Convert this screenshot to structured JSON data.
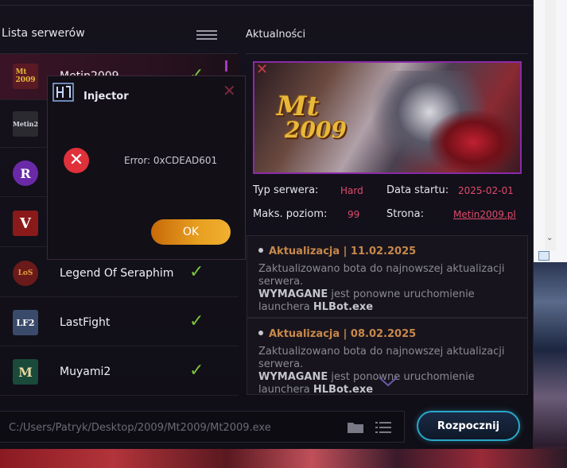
{
  "colors": {
    "accent_pink": "#e04a6a",
    "news_title": "#c8884a",
    "check_green": "#7cc43a",
    "start_border": "#2aa8c8",
    "ok_orange": "#e8a020",
    "error_red": "#e0303a"
  },
  "servers": {
    "title": "Lista serwerów",
    "menu_icon": "hamburger-menu-icon",
    "items": [
      {
        "name": "Metin2009",
        "logo": "Mt 2009",
        "logo_bg": "#5a1a24",
        "checked": true
      },
      {
        "name": "",
        "logo": "Metin2",
        "logo_bg": "#2a2a30",
        "checked": false
      },
      {
        "name": "",
        "logo": "R",
        "logo_bg": "#6a2aa8",
        "checked": false
      },
      {
        "name": "",
        "logo": "V",
        "logo_bg": "#8a1a1a",
        "checked": false
      },
      {
        "name": "Legend Of Seraphim",
        "logo": "LoS",
        "logo_bg": "#6a1a1a",
        "checked": true
      },
      {
        "name": "LastFight",
        "logo": "LF2",
        "logo_bg": "#3a4a6a",
        "checked": true
      },
      {
        "name": "Muyami2",
        "logo": "M",
        "logo_bg": "#1a4a3a",
        "checked": true
      }
    ]
  },
  "news": {
    "title": "Aktualności",
    "banner": {
      "logo_line1": "Mt",
      "logo_line2": "2009"
    },
    "info": {
      "server_type_label": "Typ serwera:",
      "server_type_value": "Hard",
      "start_date_label": "Data startu:",
      "start_date_value": "2025-02-01",
      "max_level_label": "Maks. poziom:",
      "max_level_value": "99",
      "site_label": "Strona:",
      "site_value": "Metin2009.pl"
    },
    "posts": [
      {
        "title": "Aktualizacja | 11.02.2025",
        "text": "Zaktualizowano bota do najnowszej aktualizacji serwera.",
        "bold1": "WYMAGANE",
        "text2": " jest ponowne uruchomienie launchera ",
        "bold2": "HLBot.exe"
      },
      {
        "title": "Aktualizacja | 08.02.2025",
        "text": "Zaktualizowano bota do najnowszej aktualizacji serwera.",
        "bold1": "WYMAGANE",
        "text2": " jest ponowne uruchomienie launchera ",
        "bold2": "HLBot.exe"
      }
    ]
  },
  "bottom": {
    "path": "C:/Users/Patryk/Desktop/2009/Mt2009/Mt2009.exe",
    "start_label": "Rozpocznij"
  },
  "dialog": {
    "title": "Injector",
    "message": "Error: 0xCDEAD601",
    "ok_label": "OK"
  }
}
